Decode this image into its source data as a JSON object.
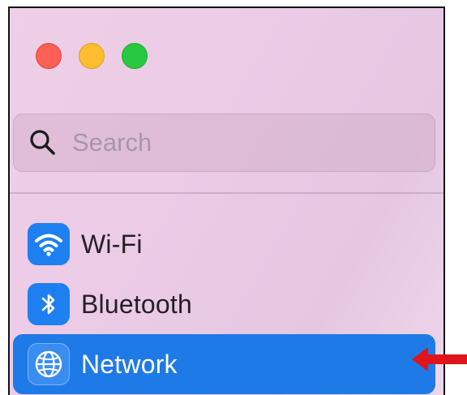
{
  "window": {
    "traffic_lights": [
      "close",
      "minimize",
      "zoom"
    ]
  },
  "search": {
    "placeholder": "Search",
    "value": "",
    "icon": "search-icon"
  },
  "sidebar": {
    "items": [
      {
        "label": "Wi-Fi",
        "icon": "wifi-icon",
        "selected": false
      },
      {
        "label": "Bluetooth",
        "icon": "bluetooth-icon",
        "selected": false
      },
      {
        "label": "Network",
        "icon": "globe-icon",
        "selected": true
      }
    ]
  },
  "colors": {
    "selection": "#1e7ae6",
    "icon_tile": "#1d7ff0",
    "close": "#fe5f57",
    "minimize": "#febc2e",
    "zoom": "#28c840",
    "annotation_arrow": "#e0141b"
  },
  "annotation": {
    "type": "arrow",
    "points_to": "sidebar-item-network"
  }
}
